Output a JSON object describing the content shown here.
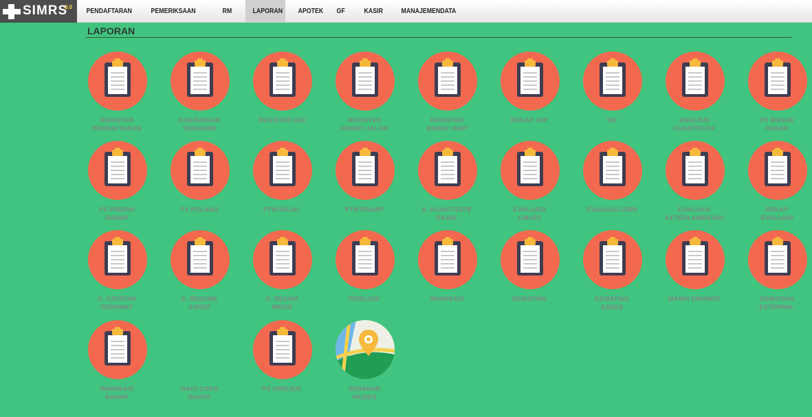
{
  "app": {
    "logo_text": "SIMRS",
    "logo_version": "3.0"
  },
  "nav": {
    "items": [
      {
        "label": "PENDAFTARAN"
      },
      {
        "label": "PEMERIKSAAN"
      },
      {
        "label": "RM"
      },
      {
        "label": "LAPORAN",
        "active": true
      },
      {
        "label": "APOTEK"
      },
      {
        "label": "GF"
      },
      {
        "label": "KASIR"
      },
      {
        "label": "MANAJEMENDATA"
      }
    ]
  },
  "page": {
    "title": "LAPORAN"
  },
  "colors": {
    "background": "#41c47f",
    "circle": "#f2694f",
    "label": "#7a8a80"
  },
  "reports": [
    {
      "label": "REGISTER\nPENDAFTARAN",
      "icon": "clipboard-icon"
    },
    {
      "label": "KUNJUNGAN\nTERAKHIR",
      "icon": "clipboard-icon"
    },
    {
      "label": "REGISTER IGD",
      "icon": "clipboard-icon"
    },
    {
      "label": "REGISTER\nRAWAT JALAN",
      "icon": "clipboard-icon"
    },
    {
      "label": "REGISTER\nRAWAT INAP",
      "icon": "clipboard-icon"
    },
    {
      "label": "REKAP JHP",
      "icon": "clipboard-icon"
    },
    {
      "label": "W2",
      "icon": "clipboard-icon"
    },
    {
      "label": "ANALISIS\nKUANTITATIF",
      "icon": "clipboard-icon"
    },
    {
      "label": "PX MASUK\nRANAP",
      "icon": "clipboard-icon"
    },
    {
      "label": "PX PINDAH\nRANAP",
      "icon": "clipboard-icon"
    },
    {
      "label": "PX PULANG",
      "icon": "clipboard-icon"
    },
    {
      "label": "PTM RAJAL",
      "icon": "clipboard-icon"
    },
    {
      "label": "PTM RANAP",
      "icon": "clipboard-icon"
    },
    {
      "label": "A. KUANTITATIF\nRAJAL",
      "icon": "clipboard-icon"
    },
    {
      "label": "EVALUASI\nCM1RJ",
      "icon": "clipboard-icon"
    },
    {
      "label": "EVALUASI CMRI",
      "icon": "clipboard-icon"
    },
    {
      "label": "EVALUASI\nKETERLAMBATAN",
      "icon": "clipboard-icon"
    },
    {
      "label": "REKAP\nEVALUASI",
      "icon": "clipboard-icon"
    },
    {
      "label": "K. CATATAN\nPERAWAT",
      "icon": "clipboard-icon"
    },
    {
      "label": "K. RESUME\nASKEP",
      "icon": "clipboard-icon"
    },
    {
      "label": "K. REKAM\nMEDIS",
      "icon": "clipboard-icon"
    },
    {
      "label": "PERUJUK",
      "icon": "clipboard-icon"
    },
    {
      "label": "IMUNISASI",
      "icon": "clipboard-icon"
    },
    {
      "label": "KEMATIAN",
      "icon": "clipboard-icon"
    },
    {
      "label": "KEMATIAN\nASKES",
      "icon": "clipboard-icon"
    },
    {
      "label": "MASIH DIRAWAT",
      "icon": "clipboard-icon"
    },
    {
      "label": "KEMATIAN\nEXTERNAL",
      "icon": "clipboard-icon"
    },
    {
      "label": "IMUNISASI\nRANAP",
      "icon": "clipboard-icon"
    },
    {
      "label": "DATA CARA\nBAYAR",
      "icon": "none"
    },
    {
      "label": "PX DIRUJUK",
      "icon": "clipboard-icon"
    },
    {
      "label": "SEBARAN\nPASIEN",
      "icon": "map-pin-icon"
    }
  ]
}
